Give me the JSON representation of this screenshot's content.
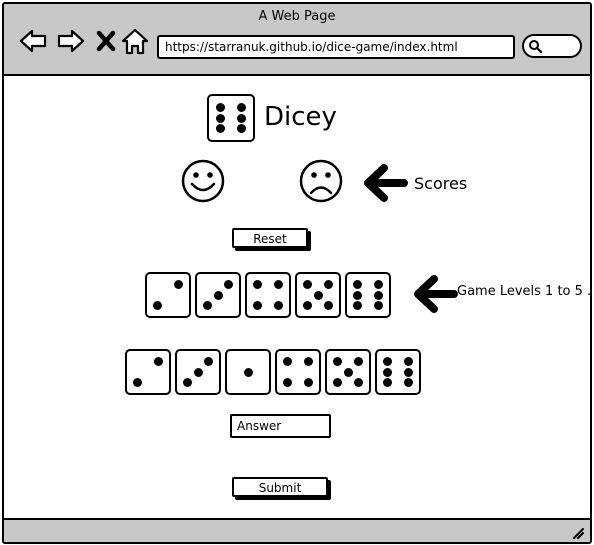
{
  "browser": {
    "title": "A Web Page",
    "url": "https://starranuk.github.io/dice-game/index.html",
    "icons": [
      "back-arrow-icon",
      "forward-arrow-icon",
      "close-icon",
      "home-icon",
      "search-icon",
      "resize-grip-icon"
    ]
  },
  "page": {
    "title": "Dicey",
    "logo_die_value": 6,
    "score_icons": [
      "smiley-face-icon",
      "sad-face-icon"
    ],
    "scores_note": "Scores",
    "reset_label": "Reset",
    "levels_note": "Game Levels 1 to 5 .",
    "level_dice": [
      2,
      3,
      4,
      5,
      6
    ],
    "puzzle_dice": [
      2,
      3,
      1,
      4,
      5,
      6
    ],
    "answer_placeholder": "Answer",
    "submit_label": "Submit"
  }
}
